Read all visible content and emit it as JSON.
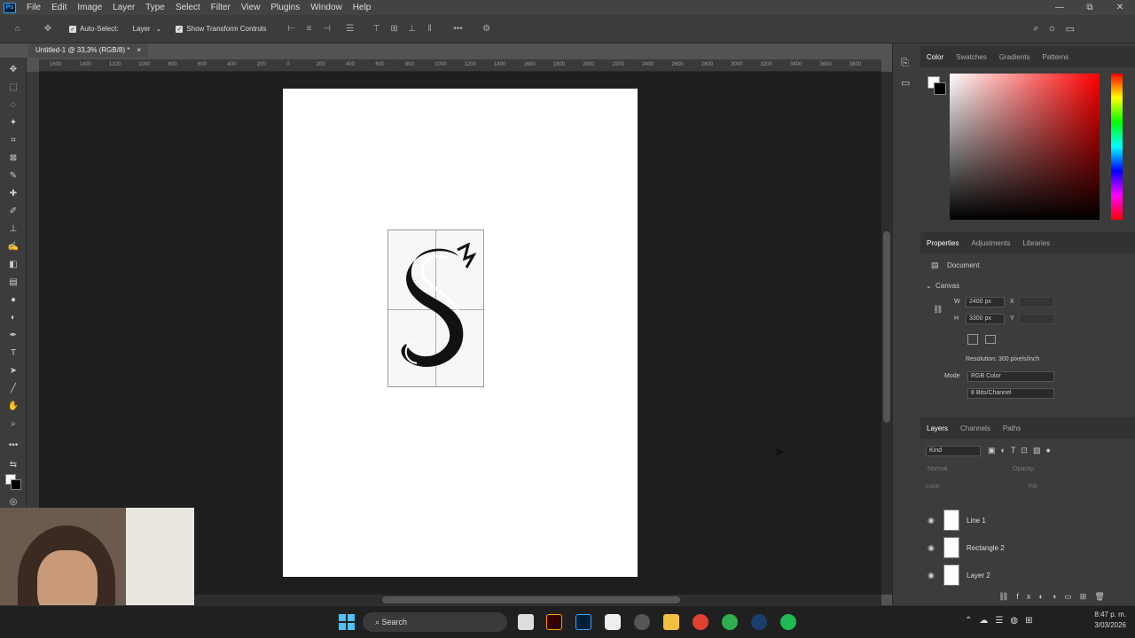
{
  "app": {
    "logo_text": "Ps"
  },
  "menu": [
    "File",
    "Edit",
    "Image",
    "Layer",
    "Type",
    "Select",
    "Filter",
    "View",
    "Plugins",
    "Window",
    "Help"
  ],
  "window_controls": [
    "—",
    "⧉",
    "✕"
  ],
  "options": {
    "auto_select": "Auto-Select:",
    "target": "Layer",
    "show_transform": "Show Transform Controls",
    "more": "•••"
  },
  "document_tab": {
    "title": "Untitled-1 @ 33,3% (RGB/8) *",
    "close": "×"
  },
  "ruler_h": [
    "1600",
    "1400",
    "1200",
    "1000",
    "800",
    "600",
    "400",
    "200",
    "0",
    "200",
    "400",
    "600",
    "800",
    "1000",
    "1200",
    "1400",
    "1600",
    "1800",
    "2000",
    "2200",
    "2400",
    "2600",
    "2800",
    "3000",
    "3200",
    "3400",
    "3600",
    "3800"
  ],
  "color_panel": {
    "tabs": [
      "Color",
      "Swatches",
      "Gradients",
      "Patterns"
    ]
  },
  "properties_panel": {
    "tabs": [
      "Properties",
      "Adjustments",
      "Libraries"
    ],
    "doc_label": "Document",
    "canvas_label": "Canvas",
    "w_label": "W",
    "w_value": "2400 px",
    "h_label": "H",
    "h_value": "3300 px",
    "x_label": "X",
    "y_label": "Y",
    "resolution": "Resolution: 300 pixels/inch",
    "mode_label": "Mode",
    "mode_value": "RGB Color",
    "bits_value": "8 Bits/Channel"
  },
  "layers_panel": {
    "tabs": [
      "Layers",
      "Channels",
      "Paths"
    ],
    "filter": "Kind",
    "blend": "Normal",
    "opacity_label": "Opacity:",
    "lock_label": "Lock:",
    "fill_label": "Fill:",
    "layers": [
      "Line 1",
      "Rectangle 2",
      "Layer 2"
    ]
  },
  "taskbar": {
    "search": "Search",
    "time": "8:47 p. m.",
    "date": "3/03/2026"
  }
}
